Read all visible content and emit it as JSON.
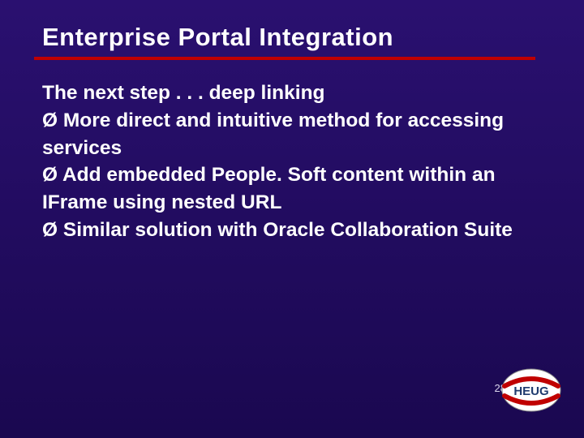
{
  "slide": {
    "title": "Enterprise Portal Integration",
    "lead": "The next step . . . deep linking",
    "bullets": [
      "More direct and intuitive method for accessing services",
      "Add embedded People. Soft content within an IFrame using nested URL",
      "Similar solution with Oracle Collaboration Suite"
    ],
    "bullet_marker": "Ø",
    "page_number": "28",
    "logo_text": "HEUG"
  }
}
